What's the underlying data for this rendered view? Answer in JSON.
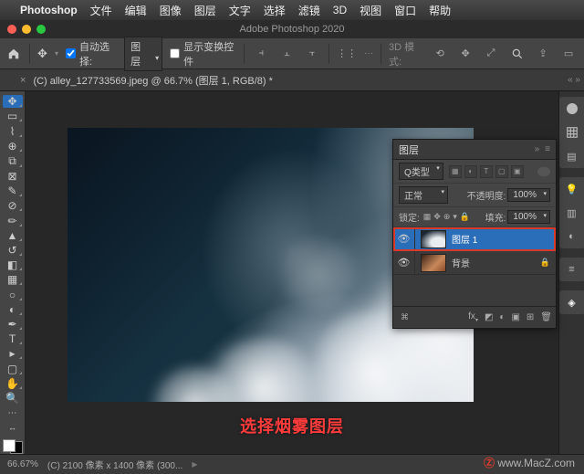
{
  "menubar": {
    "app": "Photoshop",
    "items": [
      "文件",
      "编辑",
      "图像",
      "图层",
      "文字",
      "选择",
      "滤镜",
      "3D",
      "视图",
      "窗口",
      "帮助"
    ]
  },
  "titlebar": {
    "title": "Adobe Photoshop 2020"
  },
  "options": {
    "auto_select_label": "自动选择:",
    "auto_select_target": "图层",
    "show_transform_label": "显示变换控件",
    "mode_3d": "3D 模式:"
  },
  "doc_tab": {
    "title": "(C) alley_127733569.jpeg @ 66.7% (图层 1, RGB/8) *"
  },
  "layers_panel": {
    "title": "图层",
    "filter_kind": "Q类型",
    "blend_mode": "正常",
    "opacity_label": "不透明度:",
    "opacity_value": "100%",
    "lock_label": "锁定:",
    "fill_label": "填充:",
    "fill_value": "100%",
    "layers": [
      {
        "name": "图层 1",
        "visible": true,
        "selected": true,
        "highlight": true,
        "thumb": "smoke"
      },
      {
        "name": "背景",
        "visible": true,
        "selected": false,
        "locked": true,
        "thumb": "bg"
      }
    ]
  },
  "annotation": "选择烟雾图层",
  "status": {
    "zoom": "66.67%",
    "doc_info": "(C) 2100 像素 x 1400 像素 (300..."
  },
  "watermark": {
    "text": "www.MacZ.com"
  }
}
